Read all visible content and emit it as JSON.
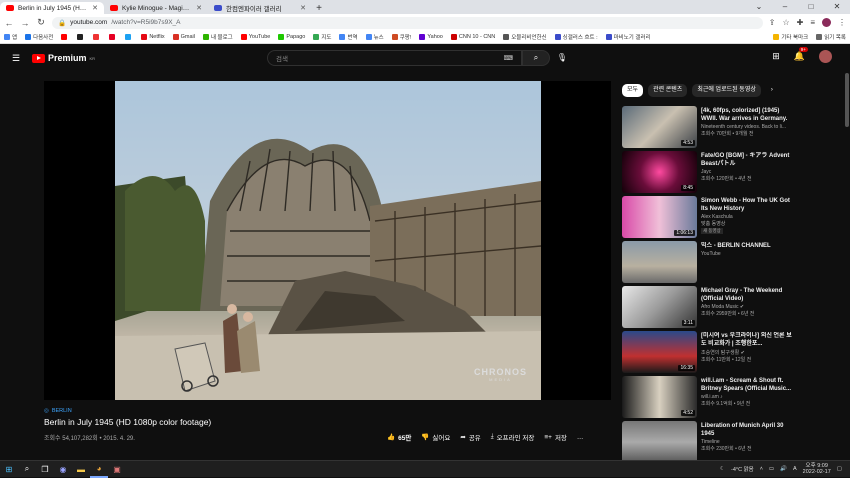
{
  "browser": {
    "tabs": [
      {
        "title": "Berlin in July 1945 (HD 108",
        "color": "#f00",
        "active": true
      },
      {
        "title": "Kylie Minogue - Magic (Extende",
        "color": "#f00",
        "active": false
      },
      {
        "title": "한컴엔파이러 갤러리",
        "color": "#3b4cca",
        "active": false
      }
    ],
    "new_tab": "+",
    "url_host": "youtube.com",
    "url_path": "/watch?v=R5i9b7s9X_A",
    "bookmarks": [
      {
        "label": "앱",
        "color": "#4285f4"
      },
      {
        "label": "다음사전",
        "color": "#1a73e8"
      },
      {
        "label": "",
        "color": "#f00"
      },
      {
        "label": "",
        "color": "#222"
      },
      {
        "label": "",
        "color": "#e33"
      },
      {
        "label": "",
        "color": "#e60023"
      },
      {
        "label": "",
        "color": "#1da1f2"
      },
      {
        "label": "Netflix",
        "color": "#e50914"
      },
      {
        "label": "Gmail",
        "color": "#d93025"
      },
      {
        "label": "내 블로그",
        "color": "#2db400"
      },
      {
        "label": "YouTube",
        "color": "#f00"
      },
      {
        "label": "Papago",
        "color": "#1ec800"
      },
      {
        "label": "지도",
        "color": "#34a853"
      },
      {
        "label": "번역",
        "color": "#4285f4"
      },
      {
        "label": "뉴스",
        "color": "#4285f4"
      },
      {
        "label": "쿠팡!",
        "color": "#ce4b23"
      },
      {
        "label": "Yahoo",
        "color": "#6001d2"
      },
      {
        "label": "CNN 10 - CNN",
        "color": "#c00"
      },
      {
        "label": "오블리비언한신",
        "color": "#555"
      },
      {
        "label": "싱갤러스 흐트 :",
        "color": "#3b4cca"
      },
      {
        "label": "마비노기 갤러리",
        "color": "#3b4cca"
      }
    ],
    "bookmarks_right": [
      "기타 북마크",
      "읽기 목록"
    ]
  },
  "youtube": {
    "logo_text": "Premium",
    "logo_sup": "KR",
    "search_placeholder": "검색",
    "notification_count": "9+",
    "video": {
      "watermark": "CHRONOS",
      "watermark_sub": "MEDIA",
      "tag": "BERLIN",
      "title": "Berlin in July 1945 (HD 1080p color footage)",
      "meta": "조회수 54,107,282회 • 2015. 4. 29.",
      "likes": "65만",
      "dislike": "싫어요",
      "share": "공유",
      "download": "오프라인 저장",
      "save": "저장"
    },
    "chips": [
      "모두",
      "관련 콘텐츠",
      "최근에 업로드된 동영상"
    ],
    "sidebar": [
      {
        "title": "[4k, 60fps, colorized] (1945) WWII. War arrives in Germany.",
        "channel": "Nineteenth century videos. Back to li...",
        "stats": "조회수 70만회 • 9개월 전",
        "duration": "4:53",
        "thumb": "linear-gradient(135deg,#5a6a78,#c9c0b0,#3a3f45)"
      },
      {
        "title": "Fate/GO [BGM] - キアラ Advent Beastパトル",
        "channel": "Jayc",
        "stats": "조회수 120만회 • 4년 전",
        "duration": "8:45",
        "thumb": "radial-gradient(circle,#ff4aa0 0%,#6a0d3a 45%,#120008 100%)"
      },
      {
        "title": "Simon Webb - How The UK Got Its New History",
        "channel": "Alex Kaschula",
        "stats": "맞춤 동영상",
        "badge": "새 동영상",
        "duration": "1:06:13",
        "thumb": "linear-gradient(90deg,#d94aa8,#f0c0d8 50%,#6a7a9a)"
      },
      {
        "title": "믹스 - BERLIN CHANNEL",
        "channel": "YouTube",
        "stats": "",
        "duration": "",
        "thumb": "linear-gradient(#8a9aa8,#b8b0a0 60%,#6a6a6a)"
      },
      {
        "title": "Michael Gray - The Weekend (Official Video)",
        "channel": "Afro Moda Music ✔",
        "stats": "조회수 2959만회 • 6년 전",
        "duration": "3:11",
        "thumb": "linear-gradient(135deg,#e8e8e8,#9a9a9a 50%,#333)"
      },
      {
        "title": "[미시여 vs 우크라이나] 외신 언론 보도 비교화가 | 조행한포...",
        "channel": "조승연의 탐구생활 ✔",
        "stats": "조회수 11만회 • 12일 전",
        "duration": "16:35",
        "thumb": "linear-gradient(#2a4a8a,#c03030 60%,#1a1a1a)"
      },
      {
        "title": "will.i.am - Scream & Shout ft. Britney Spears (Official Music...",
        "channel": "will.i.am ♪",
        "stats": "조회수 9.1억회 • 9년 전",
        "duration": "4:52",
        "thumb": "linear-gradient(90deg,#1a1a1a,#d8d0c0 50%,#2a2a2a)"
      },
      {
        "title": "Liberation of Munich April 30 1945",
        "channel": "Timeline",
        "stats": "조회수 230만회 • 6년 전",
        "duration": "",
        "thumb": "linear-gradient(#777,#aaa 50%,#555)"
      }
    ]
  },
  "taskbar": {
    "weather": "-4°C 맑음",
    "lang": "A",
    "time": "오후 9:09",
    "date": "2022-02-17"
  }
}
